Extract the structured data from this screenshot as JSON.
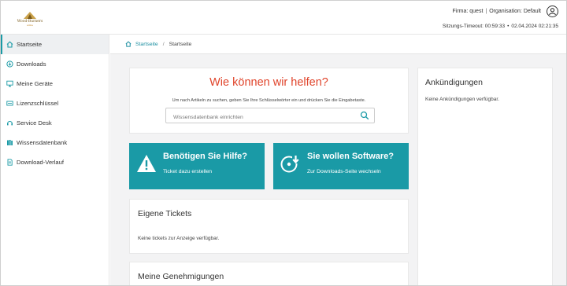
{
  "header": {
    "logo_text": "Wood-Burners",
    "logo_sub": "online",
    "firm_label": "Firma: quest",
    "org_label": "Organisation: Default",
    "timeout_label": "Sitzungs-Timeout: 00:59:33",
    "datetime": "02.04.2024 02:21:35"
  },
  "sidebar": {
    "items": [
      {
        "label": "Startseite",
        "icon": "home-icon",
        "active": true
      },
      {
        "label": "Downloads",
        "icon": "download-icon"
      },
      {
        "label": "Meine Geräte",
        "icon": "monitor-icon"
      },
      {
        "label": "Lizenzschlüssel",
        "icon": "key-icon"
      },
      {
        "label": "Service Desk",
        "icon": "service-desk-icon"
      },
      {
        "label": "Wissensdatenbank",
        "icon": "books-icon"
      },
      {
        "label": "Download-Verlauf",
        "icon": "document-icon"
      }
    ]
  },
  "breadcrumb": {
    "home": "Startseite",
    "separator": "/",
    "current": "Startseite"
  },
  "hero": {
    "title": "Wie können wir helfen?",
    "subtitle": "Um nach Artikeln zu suchen, geben Sie Ihre Schlüsselwörter ein und drücken Sie die Eingabetaste.",
    "search_placeholder": "Wissensdatenbank einrichten"
  },
  "tiles": {
    "help": {
      "title": "Benötigen Sie Hilfe?",
      "subtitle": "Ticket dazu erstellen",
      "icon": "warning-icon"
    },
    "software": {
      "title": "Sie wollen Software?",
      "subtitle": "Zur Downloads-Seite wechseln",
      "icon": "disc-download-icon"
    }
  },
  "tickets": {
    "title": "Eigene Tickets",
    "empty_text": "Keine tickets zur Anzeige verfügbar."
  },
  "approvals": {
    "title": "Meine Genehmigungen"
  },
  "announcements": {
    "title": "Ankündigungen",
    "empty_text": "Keine Ankündigungen verfügbar."
  },
  "colors": {
    "accent": "#1a9aa6",
    "hero_title": "#e0442b",
    "background": "#f3f3f4"
  }
}
